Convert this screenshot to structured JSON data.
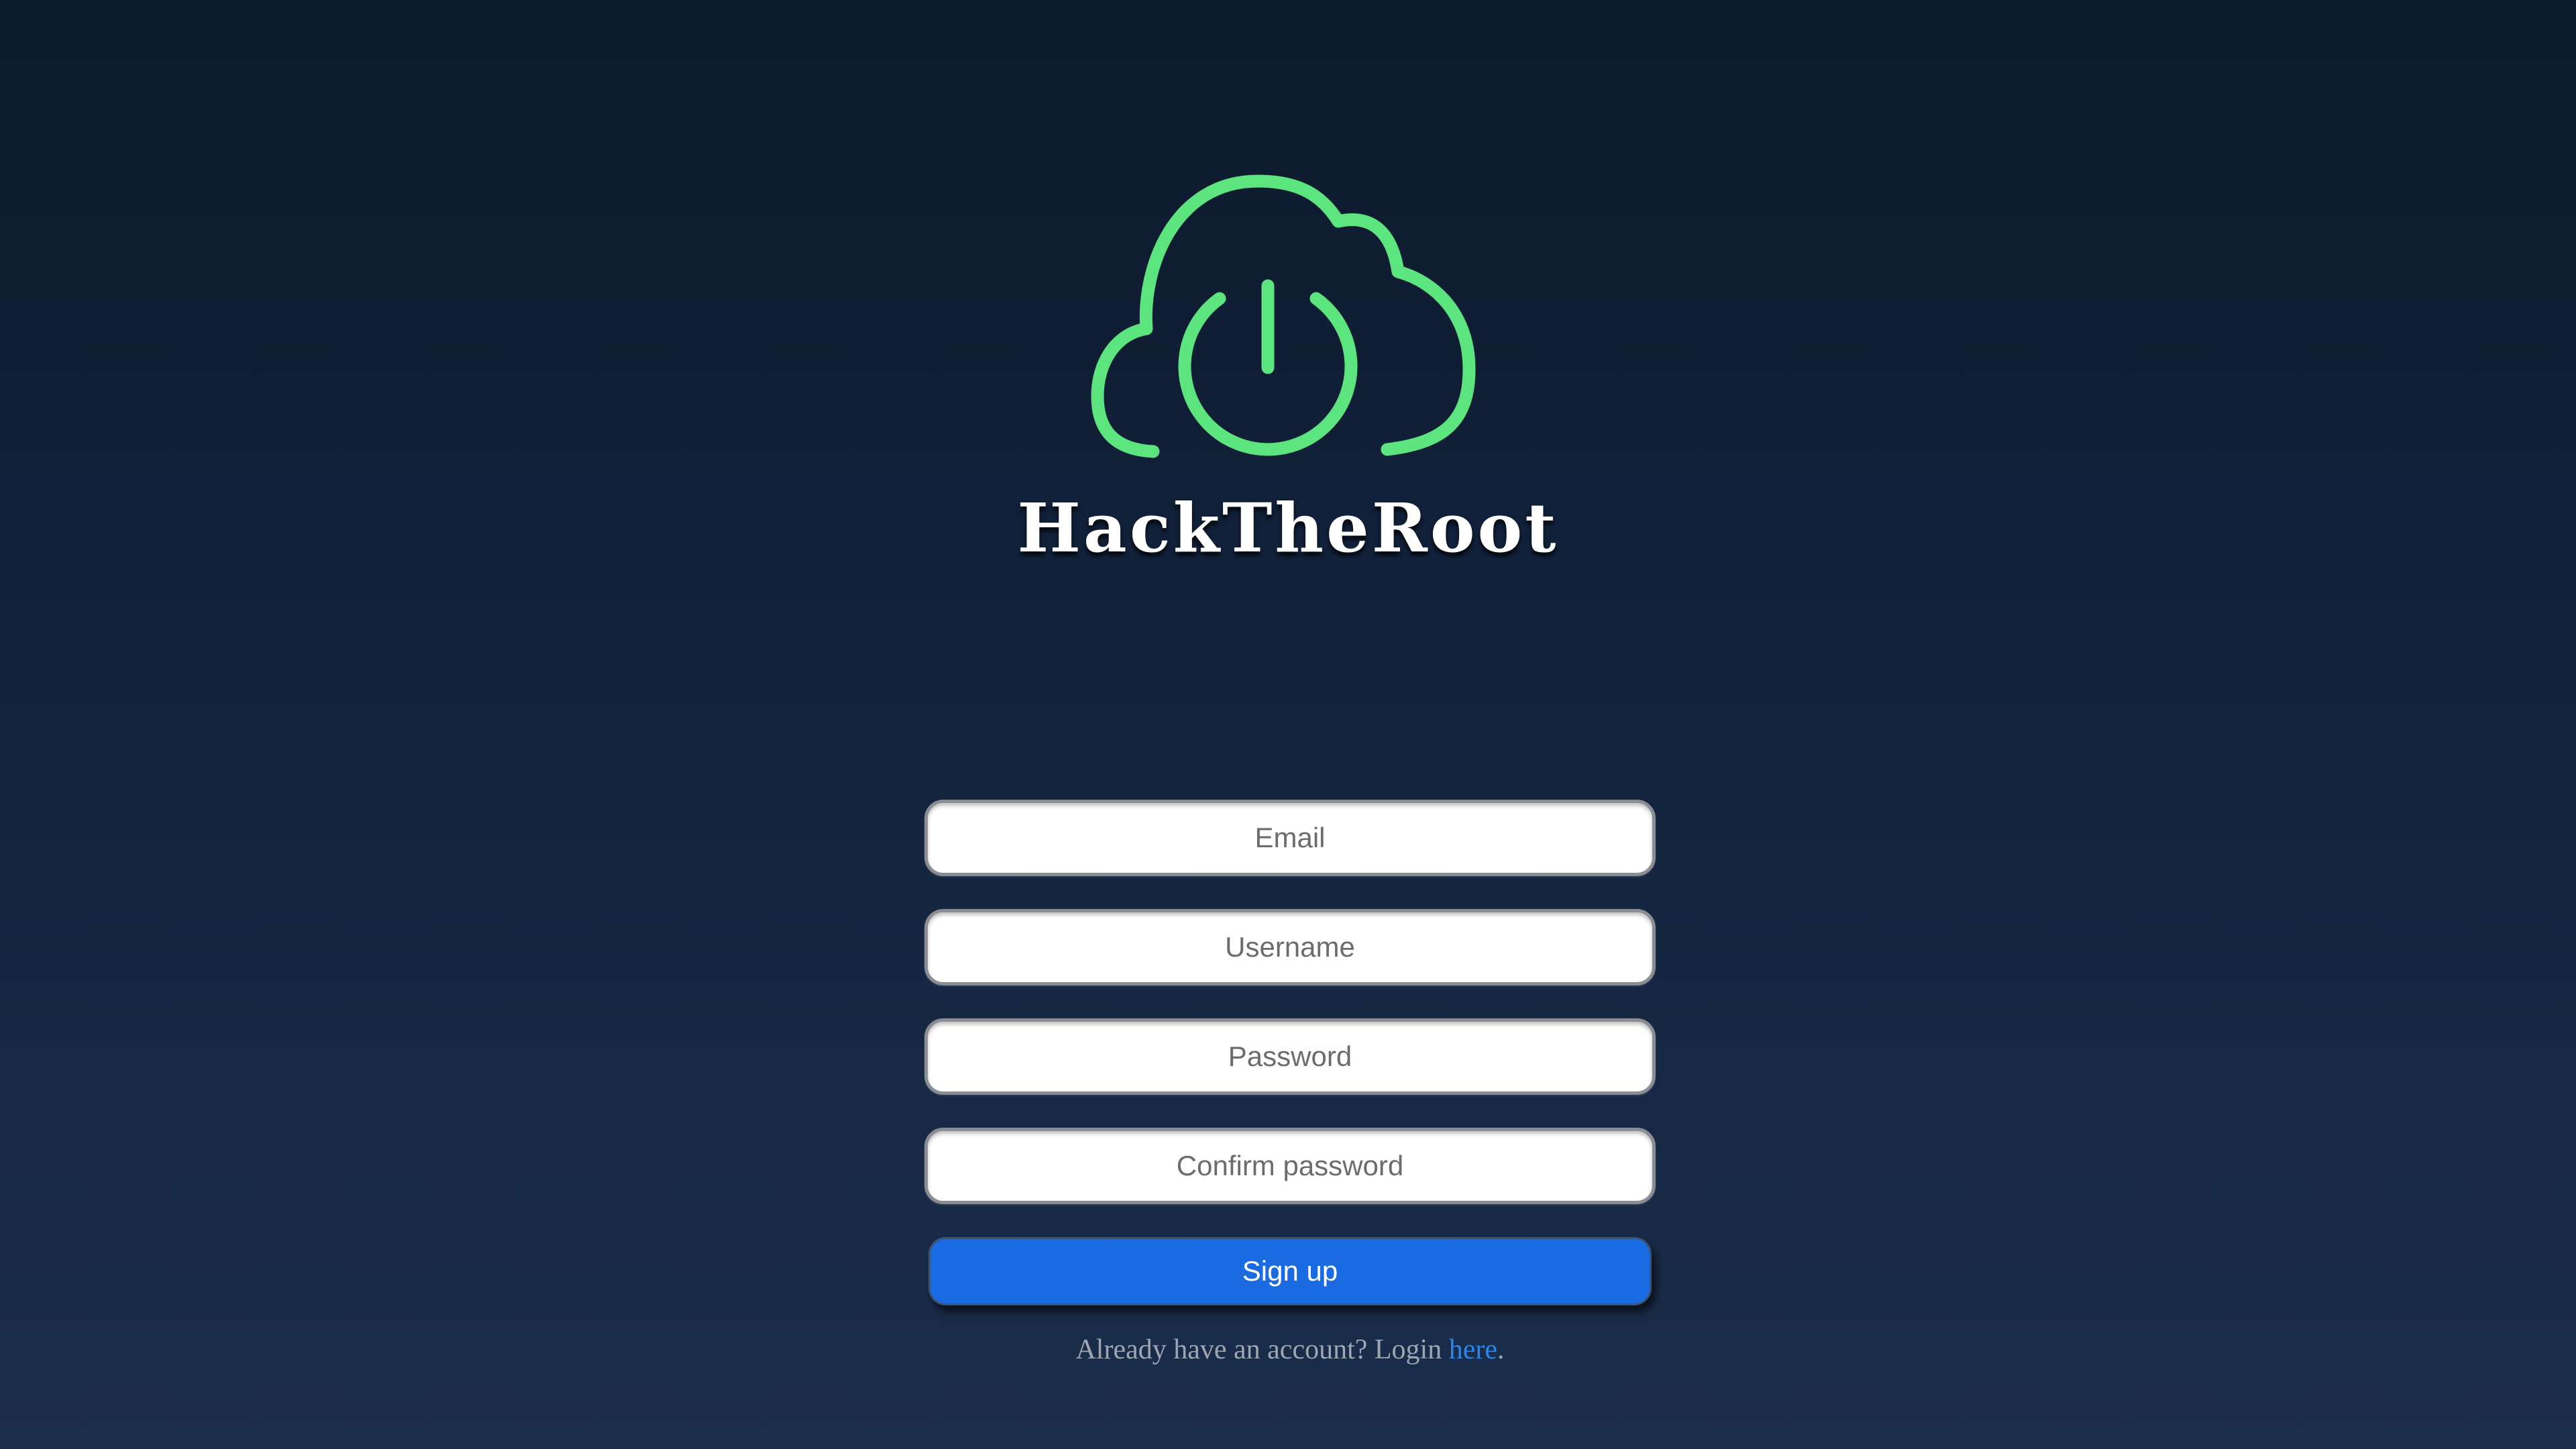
{
  "brand": {
    "name": "HackTheRoot",
    "logo_icon": "cloud-power-icon",
    "logo_color": "#5ce57e"
  },
  "form": {
    "email_placeholder": "Email",
    "username_placeholder": "Username",
    "password_placeholder": "Password",
    "confirm_password_placeholder": "Confirm password",
    "signup_label": "Sign up",
    "login_prompt": "Already have an account? Login ",
    "login_link_label": "here",
    "login_suffix": "."
  },
  "colors": {
    "accent": "#1a6ae1",
    "link": "#2a86e8",
    "background_top": "#0d1a2c",
    "background_bottom": "#1a2d4b"
  }
}
